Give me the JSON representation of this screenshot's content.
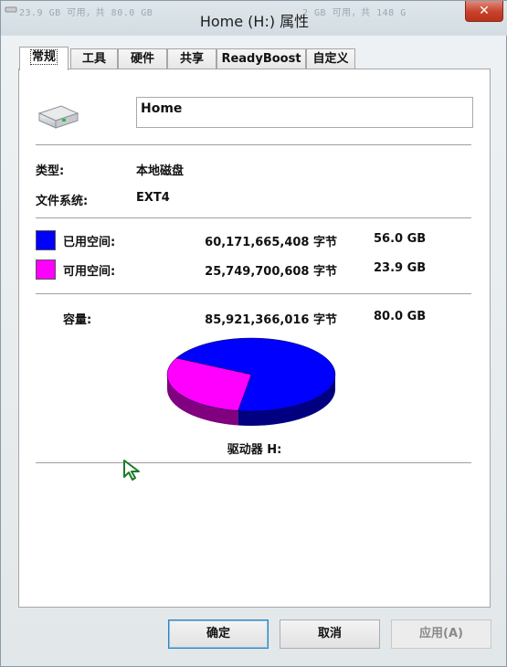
{
  "window": {
    "title": "Home (H:) 属性",
    "bg_blur_left": "23.9 GB 可用，共 80.0 GB",
    "bg_blur_right": "2 GB 可用，共 148 G",
    "close_glyph": "✕"
  },
  "tabs": [
    {
      "label": "常规",
      "active": true
    },
    {
      "label": "工具"
    },
    {
      "label": "硬件"
    },
    {
      "label": "共享"
    },
    {
      "label": "ReadyBoost"
    },
    {
      "label": "自定义"
    }
  ],
  "general": {
    "volume_name": "Home",
    "type_label": "类型:",
    "type_value": "本地磁盘",
    "fs_label": "文件系统:",
    "fs_value": "EXT4",
    "used_label": "已用空间:",
    "used_bytes": "60,171,665,408 字节",
    "used_size": "56.0 GB",
    "free_label": "可用空间:",
    "free_bytes": "25,749,700,608 字节",
    "free_size": "23.9 GB",
    "capacity_label": "容量:",
    "capacity_bytes": "85,921,366,016 字节",
    "capacity_size": "80.0 GB",
    "drive_label": "驱动器 H:"
  },
  "colors": {
    "used": "#0000ff",
    "free": "#ff00ff",
    "used_side": "#000080",
    "free_side": "#800080",
    "accent": "#3c7fb1"
  },
  "pie": {
    "used_fraction": 0.7003,
    "free_fraction": 0.2997
  },
  "buttons": {
    "ok": "确定",
    "cancel": "取消",
    "apply": "应用(A)"
  },
  "icons": {
    "drive": "hard-drive-icon",
    "cursor": "mouse-pointer-icon",
    "close": "close-icon"
  }
}
